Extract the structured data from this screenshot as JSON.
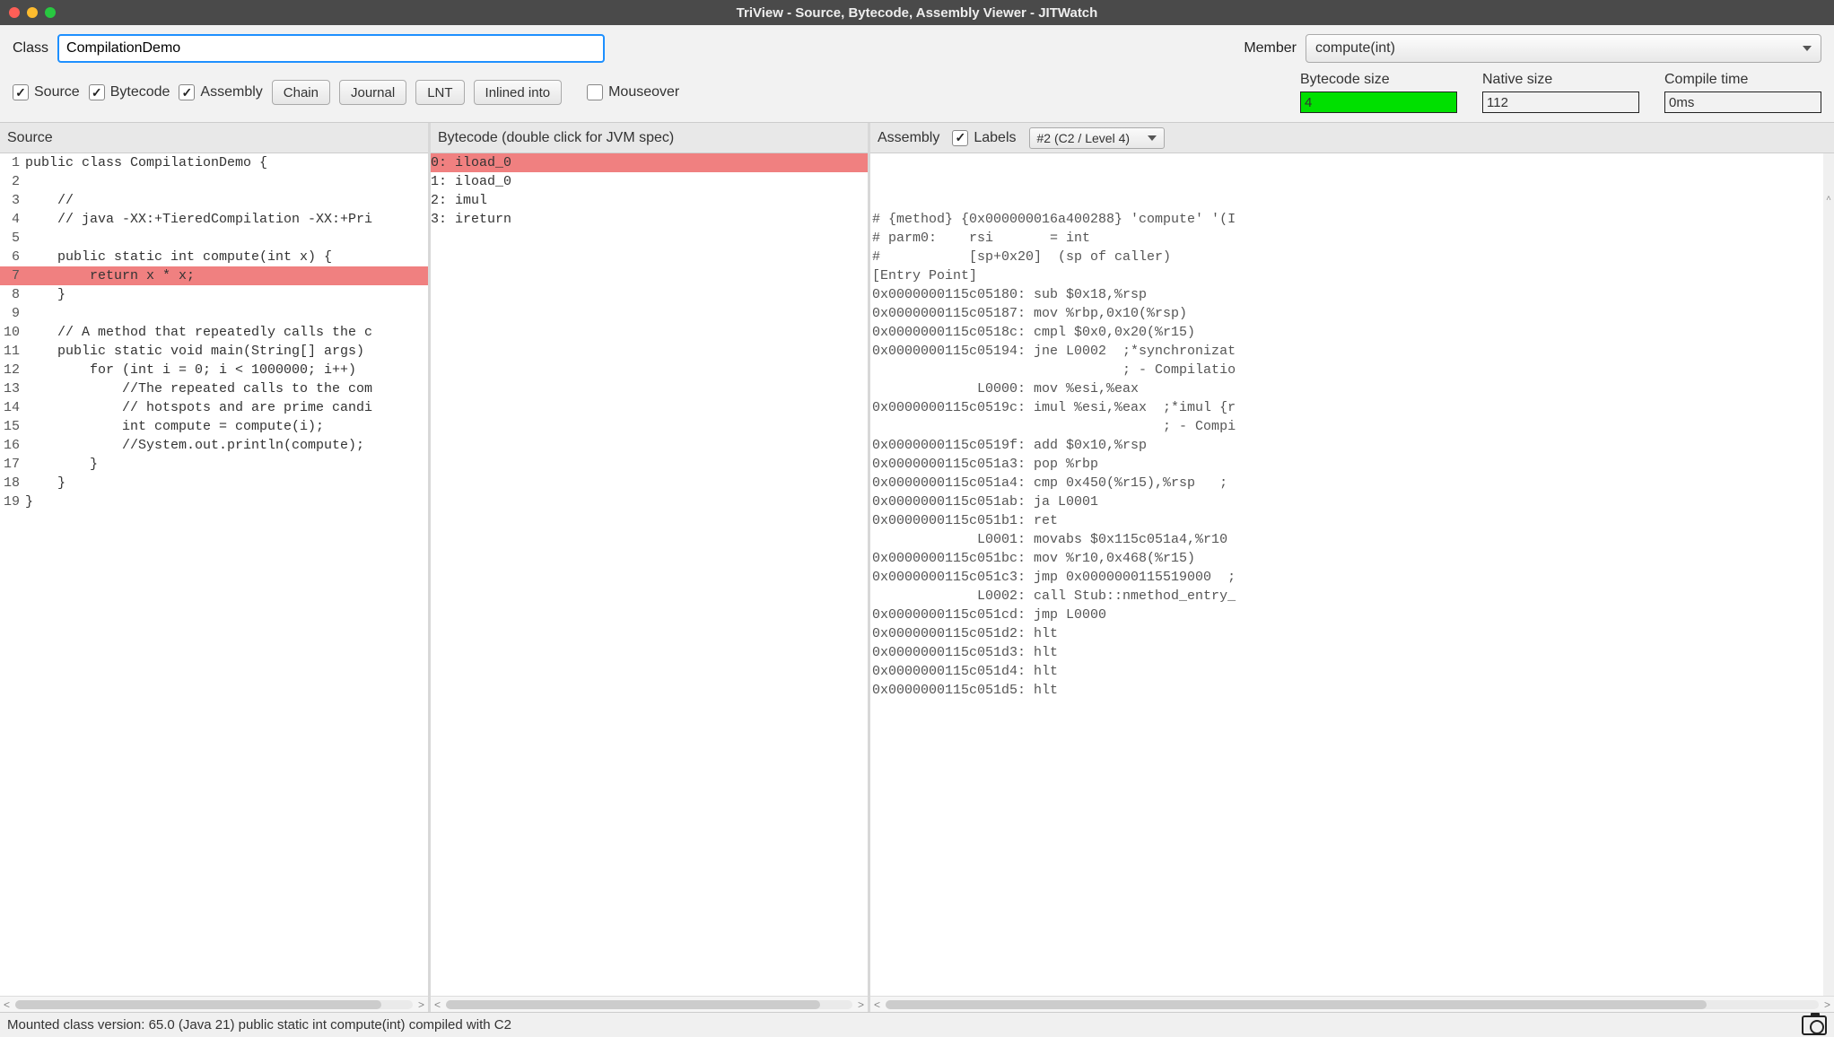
{
  "window": {
    "title": "TriView - Source, Bytecode, Assembly Viewer - JITWatch"
  },
  "toolbar": {
    "class_label": "Class",
    "class_value": "CompilationDemo",
    "member_label": "Member",
    "member_value": "compute(int)",
    "source_label": "Source",
    "bytecode_label": "Bytecode",
    "assembly_label": "Assembly",
    "chain_label": "Chain",
    "journal_label": "Journal",
    "lnt_label": "LNT",
    "inlined_label": "Inlined into",
    "mouseover_label": "Mouseover"
  },
  "stats": {
    "bytecode_label": "Bytecode size",
    "bytecode_value": "4",
    "native_label": "Native size",
    "native_value": "112",
    "compile_label": "Compile time",
    "compile_value": "0ms"
  },
  "panels": {
    "source_title": "Source",
    "bytecode_title": "Bytecode (double click for JVM spec)",
    "assembly_title": "Assembly",
    "labels_label": "Labels",
    "asm_version": "#2  (C2 / Level 4)"
  },
  "source_lines": [
    {
      "n": "1",
      "t": "public class CompilationDemo {",
      "hl": false
    },
    {
      "n": "2",
      "t": "",
      "hl": false
    },
    {
      "n": "3",
      "t": "    //",
      "hl": false
    },
    {
      "n": "4",
      "t": "    // java -XX:+TieredCompilation -XX:+Pri",
      "hl": false
    },
    {
      "n": "5",
      "t": "",
      "hl": false
    },
    {
      "n": "6",
      "t": "    public static int compute(int x) {",
      "hl": false
    },
    {
      "n": "7",
      "t": "        return x * x;",
      "hl": true
    },
    {
      "n": "8",
      "t": "    }",
      "hl": false
    },
    {
      "n": "9",
      "t": "",
      "hl": false
    },
    {
      "n": "10",
      "t": "    // A method that repeatedly calls the c",
      "hl": false
    },
    {
      "n": "11",
      "t": "    public static void main(String[] args)",
      "hl": false
    },
    {
      "n": "12",
      "t": "        for (int i = 0; i < 1000000; i++) ",
      "hl": false
    },
    {
      "n": "13",
      "t": "            //The repeated calls to the com",
      "hl": false
    },
    {
      "n": "14",
      "t": "            // hotspots and are prime candi",
      "hl": false
    },
    {
      "n": "15",
      "t": "            int compute = compute(i);",
      "hl": false
    },
    {
      "n": "16",
      "t": "            //System.out.println(compute);",
      "hl": false
    },
    {
      "n": "17",
      "t": "        }",
      "hl": false
    },
    {
      "n": "18",
      "t": "    }",
      "hl": false
    },
    {
      "n": "19",
      "t": "}",
      "hl": false
    }
  ],
  "bytecode_lines": [
    {
      "t": "0: iload_0",
      "hl": true
    },
    {
      "t": "1: iload_0",
      "hl": false
    },
    {
      "t": "2: imul",
      "hl": false
    },
    {
      "t": "3: ireturn",
      "hl": false
    }
  ],
  "asm_lines": [
    "# {method} {0x000000016a400288} 'compute' '(I",
    "# parm0:    rsi       = int",
    "#           [sp+0x20]  (sp of caller)",
    "[Entry Point]",
    "0x0000000115c05180: sub $0x18,%rsp",
    "0x0000000115c05187: mov %rbp,0x10(%rsp)",
    "0x0000000115c0518c: cmpl $0x0,0x20(%r15)",
    "0x0000000115c05194: jne L0002  ;*synchronizat",
    "                               ; - Compilatio",
    "             L0000: mov %esi,%eax",
    "0x0000000115c0519c: imul %esi,%eax  ;*imul {r",
    "                                    ; - Compi",
    "0x0000000115c0519f: add $0x10,%rsp",
    "0x0000000115c051a3: pop %rbp",
    "0x0000000115c051a4: cmp 0x450(%r15),%rsp   ;",
    "0x0000000115c051ab: ja L0001",
    "0x0000000115c051b1: ret",
    "             L0001: movabs $0x115c051a4,%r10",
    "0x0000000115c051bc: mov %r10,0x468(%r15)",
    "0x0000000115c051c3: jmp 0x0000000115519000  ;",
    "             L0002: call Stub::nmethod_entry_",
    "0x0000000115c051cd: jmp L0000",
    "0x0000000115c051d2: hlt",
    "0x0000000115c051d3: hlt",
    "0x0000000115c051d4: hlt",
    "0x0000000115c051d5: hlt"
  ],
  "statusbar": {
    "text": "Mounted class version: 65.0 (Java 21) public static int compute(int) compiled with C2"
  }
}
